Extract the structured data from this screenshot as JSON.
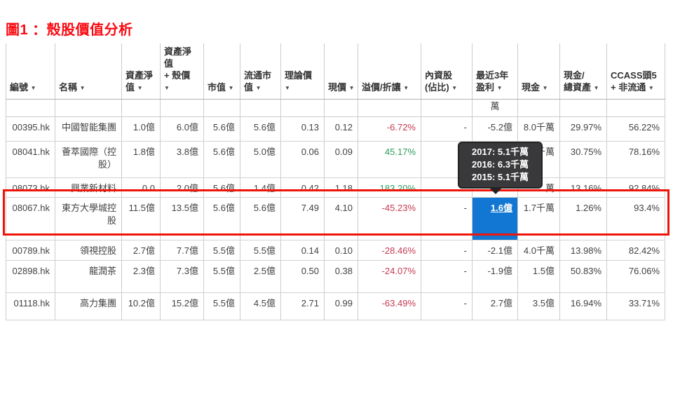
{
  "title": "圖1 ：殼股價值分析",
  "colors": {
    "title_red": "#fa0a12",
    "highlight_red": "#ee1408",
    "accent_blue": "#1277d3",
    "negative_red": "#c63a52",
    "positive_green": "#2f9c5c",
    "tooltip_bg": "#39393b"
  },
  "icons": {
    "sort_arrow": "▼"
  },
  "tooltip": {
    "lines": [
      "2017: 5.1千萬",
      "2016: 6.3千萬",
      "2015: 5.1千萬"
    ]
  },
  "table": {
    "headers": {
      "code": "編號 ▼",
      "name": "名稱 ▼",
      "nav": "資產淨\n值 ▼",
      "nav_shell": "資產淨\n值\n+ 殼價\n▼",
      "mcap": "市值 ▼",
      "float_mcap": "流通市\n值 ▼",
      "theo_price": "理論價\n▼",
      "price": "現價 ▼",
      "premium": "溢價/折讓 ▼",
      "domestic": "內資股\n(佔比) ▼",
      "profit": "最近3年\n盈利 ▼",
      "cash": "現金 ▼",
      "cash_ratio": "現金/\n總資產 ▼",
      "ccass": "CCASS頭5\n+ 非流通 ▼"
    },
    "unit_row": {
      "profit_text": "萬"
    },
    "rows": [
      {
        "code": "00395.hk",
        "name": "中國智能集團",
        "nav": "1.0億",
        "nav_shell": "6.0億",
        "mcap": "5.6億",
        "float_mcap": "5.6億",
        "theo_price": "0.13",
        "price": "0.12",
        "premium": "-6.72%",
        "premium_dir": "down",
        "domestic": "-",
        "profit": "-5.2億",
        "cash": "8.0千萬",
        "cash_ratio": "29.97%",
        "ccass": "56.22%"
      },
      {
        "code": "08041.hk",
        "name": "薈萃國際（控股）",
        "nav": "1.8億",
        "nav_shell": "3.8億",
        "mcap": "5.6億",
        "float_mcap": "5.0億",
        "theo_price": "0.06",
        "price": "0.09",
        "premium": "45.17%",
        "premium_dir": "up",
        "domestic": "",
        "profit": "",
        "cash": "千萬",
        "cash_ratio": "30.75%",
        "ccass": "78.16%"
      },
      {
        "code": "08073.hk",
        "name": "興業新材料",
        "nav": "0.0",
        "nav_shell": "2.0億",
        "mcap": "5.6億",
        "float_mcap": "1.4億",
        "theo_price": "0.42",
        "price": "1.18",
        "premium": "183.20%",
        "premium_dir": "up",
        "domestic": "",
        "profit": "",
        "cash": "萬",
        "cash_ratio": "13.16%",
        "ccass": "92.84%"
      },
      {
        "code": "08067.hk",
        "name": "東方大學城控股",
        "nav": "11.5億",
        "nav_shell": "13.5億",
        "mcap": "5.6億",
        "float_mcap": "5.6億",
        "theo_price": "7.49",
        "price": "4.10",
        "premium": "-45.23%",
        "premium_dir": "down",
        "domestic": "-",
        "profit": "1.6億",
        "profit_selected": true,
        "highlighted": true,
        "cash": "1.7千萬",
        "cash_ratio": "1.26%",
        "ccass": "93.4%"
      },
      {
        "code": "00789.hk",
        "name": "領視控股",
        "nav": "2.7億",
        "nav_shell": "7.7億",
        "mcap": "5.5億",
        "float_mcap": "5.5億",
        "theo_price": "0.14",
        "price": "0.10",
        "premium": "-28.46%",
        "premium_dir": "down",
        "domestic": "-",
        "profit": "-2.1億",
        "cash": "4.0千萬",
        "cash_ratio": "13.98%",
        "ccass": "82.42%"
      },
      {
        "code": "02898.hk",
        "name": "龍潤茶",
        "nav": "2.3億",
        "nav_shell": "7.3億",
        "mcap": "5.5億",
        "float_mcap": "2.5億",
        "theo_price": "0.50",
        "price": "0.38",
        "premium": "-24.07%",
        "premium_dir": "down",
        "domestic": "-",
        "profit": "-1.9億",
        "cash": "1.5億",
        "cash_ratio": "50.83%",
        "ccass": "76.06%"
      },
      {
        "code": "01118.hk",
        "name": "高力集團",
        "nav": "10.2億",
        "nav_shell": "15.2億",
        "mcap": "5.5億",
        "float_mcap": "4.5億",
        "theo_price": "2.71",
        "price": "0.99",
        "premium": "-63.49%",
        "premium_dir": "down",
        "domestic": "-",
        "profit": "2.7億",
        "cash": "3.5億",
        "cash_ratio": "16.94%",
        "ccass": "33.71%"
      }
    ]
  }
}
